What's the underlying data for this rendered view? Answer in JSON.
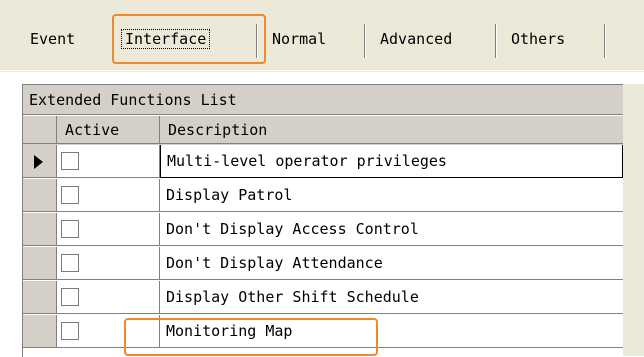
{
  "tabs": [
    {
      "label": "Event"
    },
    {
      "label": "Interface",
      "selected": true
    },
    {
      "label": "Normal"
    },
    {
      "label": "Advanced"
    },
    {
      "label": "Others"
    }
  ],
  "grid": {
    "caption": "Extended Functions List",
    "columns": {
      "active": "Active",
      "description": "Description"
    },
    "rows": [
      {
        "active": false,
        "description": "Multi-level operator privileges",
        "current": true
      },
      {
        "active": false,
        "description": "Display Patrol"
      },
      {
        "active": false,
        "description": "Don't Display Access Control"
      },
      {
        "active": false,
        "description": "Don't Display Attendance"
      },
      {
        "active": false,
        "description": "Display Other Shift Schedule"
      },
      {
        "active": false,
        "description": "Monitoring Map"
      }
    ]
  },
  "colors": {
    "highlight": "#f0882c",
    "panel": "#ece9d8",
    "grid_header": "#d4d0c8"
  },
  "icons": [
    "current-row-arrow-icon",
    "checkbox-icon"
  ]
}
